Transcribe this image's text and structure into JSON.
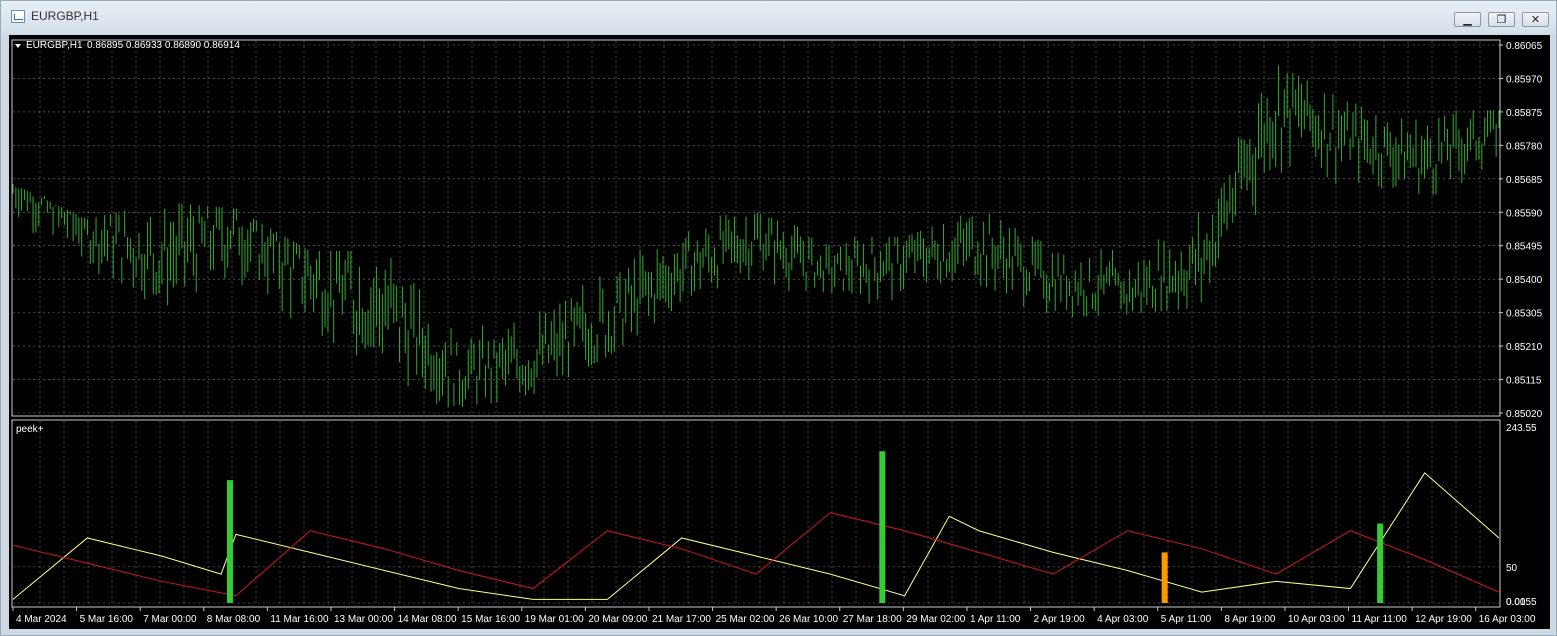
{
  "window": {
    "title": "EURGBP,H1",
    "buttons": {
      "minimize": "▁",
      "restore": "❐",
      "close": "✕"
    }
  },
  "chart_info": {
    "symbol": "EURGBP,H1",
    "ohlc": "0.86895 0.86933 0.86890 0.86914"
  },
  "indicator": {
    "name": "peek+"
  },
  "colors": {
    "background": "#000000",
    "price": "#2fae2f",
    "grid": "#7a7a7a",
    "ind_yellow": "#ffff88",
    "ind_red": "#d11919",
    "ind_green": "#33cc33",
    "ind_orange": "#ff9900"
  },
  "chart_data": [
    {
      "type": "bar",
      "ylim": [
        0.8502,
        0.86065
      ],
      "yticks": [
        "0.86065",
        "0.85970",
        "0.85875",
        "0.85780",
        "0.85685",
        "0.85590",
        "0.85495",
        "0.85400",
        "0.85305",
        "0.85210",
        "0.85115",
        "0.85020"
      ],
      "grid": true,
      "x": [
        0,
        5,
        10,
        15,
        20,
        25,
        30,
        35,
        40,
        45,
        50,
        55,
        60,
        65,
        70,
        75,
        80,
        85,
        90,
        95,
        100
      ],
      "close": [
        0.8566,
        0.8554,
        0.8546,
        0.8555,
        0.8541,
        0.8532,
        0.8513,
        0.8517,
        0.8528,
        0.8543,
        0.8552,
        0.8542,
        0.8546,
        0.855,
        0.854,
        0.8536,
        0.8545,
        0.859,
        0.858,
        0.8574,
        0.8583
      ],
      "range_high": [
        0.8567,
        0.8557,
        0.8562,
        0.856,
        0.8548,
        0.8548,
        0.8525,
        0.8531,
        0.8549,
        0.8557,
        0.8559,
        0.8552,
        0.8552,
        0.856,
        0.8549,
        0.855,
        0.856,
        0.8601,
        0.859,
        0.8588,
        0.8588
      ],
      "range_low": [
        0.8552,
        0.8537,
        0.8532,
        0.853,
        0.8518,
        0.8508,
        0.8503,
        0.8507,
        0.8518,
        0.8533,
        0.8537,
        0.8536,
        0.853,
        0.8537,
        0.8529,
        0.853,
        0.8532,
        0.8563,
        0.8568,
        0.8563,
        0.857
      ]
    },
    {
      "type": "line",
      "ylim": [
        0,
        243.55
      ],
      "yticks": [
        "243.55",
        "50",
        "0.00",
        "0.0155"
      ],
      "series": [
        {
          "color": "yellow",
          "x": [
            0,
            5,
            10,
            14,
            15,
            20,
            25,
            30,
            35,
            40,
            45,
            50,
            55,
            60,
            63,
            65,
            70,
            75,
            80,
            85,
            90,
            95,
            100
          ],
          "y": [
            5,
            90,
            65,
            40,
            95,
            70,
            45,
            20,
            5,
            5,
            90,
            65,
            40,
            10,
            120,
            100,
            70,
            45,
            15,
            30,
            20,
            180,
            90
          ]
        },
        {
          "color": "red",
          "x": [
            0,
            5,
            10,
            15,
            20,
            25,
            30,
            35,
            40,
            45,
            50,
            55,
            60,
            65,
            70,
            75,
            80,
            85,
            90,
            95,
            100
          ],
          "y": [
            80,
            55,
            30,
            10,
            100,
            75,
            45,
            20,
            100,
            75,
            40,
            125,
            100,
            70,
            40,
            100,
            75,
            40,
            100,
            60,
            15
          ]
        }
      ],
      "spikes": [
        {
          "color": "green",
          "x": 14.6,
          "y": 170
        },
        {
          "color": "green",
          "x": 58.5,
          "y": 210
        },
        {
          "color": "orange",
          "x": 77.5,
          "y": 70
        },
        {
          "color": "green",
          "x": 92.0,
          "y": 110
        }
      ]
    }
  ],
  "time_axis": [
    "4 Mar 2024",
    "5 Mar 16:00",
    "7 Mar 00:00",
    "8 Mar 08:00",
    "11 Mar 16:00",
    "13 Mar 00:00",
    "14 Mar 08:00",
    "15 Mar 16:00",
    "19 Mar 01:00",
    "20 Mar 09:00",
    "21 Mar 17:00",
    "25 Mar 02:00",
    "26 Mar 10:00",
    "27 Mar 18:00",
    "29 Mar 02:00",
    "1 Apr 11:00",
    "2 Apr 19:00",
    "4 Apr 03:00",
    "5 Apr 11:00",
    "8 Apr 19:00",
    "10 Apr 03:00",
    "11 Apr 11:00",
    "12 Apr 19:00",
    "16 Apr 03:00"
  ]
}
